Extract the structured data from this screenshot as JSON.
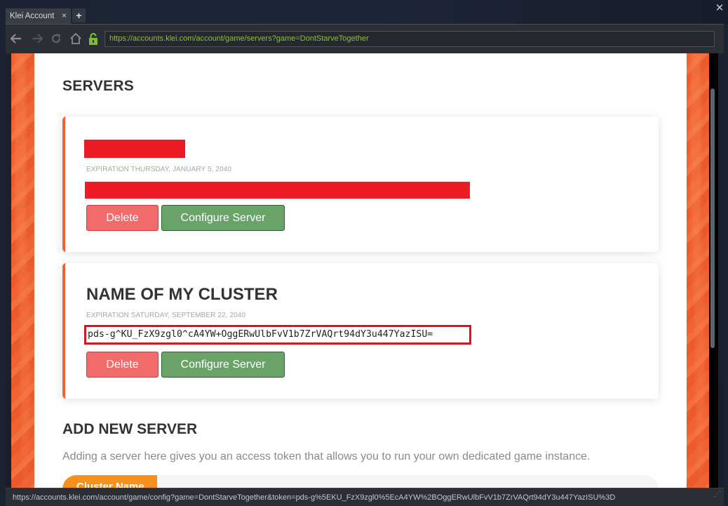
{
  "browser": {
    "tab_title": "Klei Account",
    "tab_close_icon": "×",
    "new_tab_icon": "+",
    "window_close_icon": "✕",
    "url": "https://accounts.klei.com/account/game/servers?game=DontStarveTogether",
    "status_url": "https://accounts.klei.com/account/game/config?game=DontStarveTogether&token=pds-g%5EKU_FzX9zgl0%5EcA4YW%2BOggERwUlbFvV1b7ZrVAQrt94dY3u447YazISU%3D",
    "nav_icons": [
      "back-arrow-icon",
      "forward-arrow-icon",
      "reload-icon",
      "home-icon",
      "lock-icon"
    ],
    "accent_color": "#8fbf3e"
  },
  "page": {
    "servers_heading": "SERVERS",
    "servers": [
      {
        "name": "",
        "name_redacted": true,
        "expiration": "EXPIRATION THURSDAY, JANUARY 5, 2040",
        "token": "",
        "token_redacted": true,
        "delete_label": "Delete",
        "configure_label": "Configure Server"
      },
      {
        "name": "NAME OF MY CLUSTER",
        "name_redacted": false,
        "expiration": "EXPIRATION SATURDAY, SEPTEMBER 22, 2040",
        "token": "pds-g^KU_FzX9zgl0^cA4YW+OggERwUlbFvV1b7ZrVAQrt94dY3u447YazISU=",
        "token_redacted": false,
        "delete_label": "Delete",
        "configure_label": "Configure Server"
      }
    ],
    "add_heading": "ADD NEW SERVER",
    "add_description": "Adding a server here gives you an access token that allows you to run your own dedicated game instance.",
    "cluster_name_label": "Cluster Name",
    "cluster_name_value": "",
    "colors": {
      "brand_orange": "#f0632f",
      "redaction": "#ed1c24",
      "delete": "#f26b6b",
      "configure": "#6aa36a",
      "cluster_tab": "#f7901e"
    }
  }
}
